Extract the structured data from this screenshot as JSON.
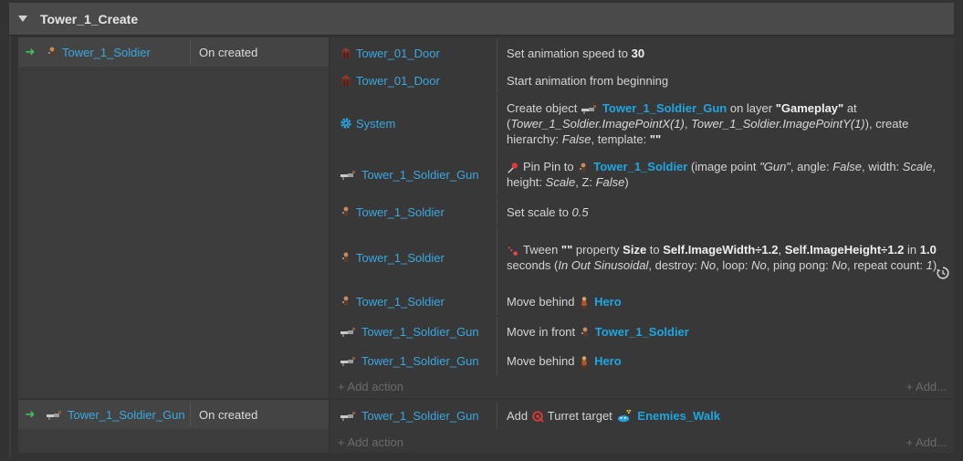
{
  "group": {
    "title": "Tower_1_Create"
  },
  "events": [
    {
      "object": "Tower_1_Soldier",
      "condition": "On created",
      "actions": [
        {
          "object": "Tower_01_Door",
          "text": [
            "Set animation speed to ",
            {
              "b": "30"
            }
          ]
        },
        {
          "object": "Tower_01_Door",
          "text": [
            "Start animation from beginning"
          ]
        },
        {
          "object": "System",
          "text": [
            "Create object ",
            {
              "icon": "soldier-gun-icon"
            },
            {
              "o": "Tower_1_Soldier_Gun"
            },
            " on layer ",
            {
              "b": "\"Gameplay\""
            },
            " at (",
            {
              "i": "Tower_1_Soldier.ImagePointX(1)"
            },
            ", ",
            {
              "i": "Tower_1_Soldier.ImagePointY(1)"
            },
            "), create hierarchy: ",
            {
              "i": "False"
            },
            ", template: ",
            {
              "b": "\"\""
            }
          ]
        },
        {
          "object": "Tower_1_Soldier_Gun",
          "text": [
            {
              "icon": "pin-icon"
            },
            "Pin Pin to ",
            {
              "icon": "soldier-icon"
            },
            {
              "o": "Tower_1_Soldier"
            },
            " (image point ",
            {
              "i": "\"Gun\""
            },
            ", angle: ",
            {
              "i": "False"
            },
            ", width: ",
            {
              "i": "Scale"
            },
            ", height: ",
            {
              "i": "Scale"
            },
            ", Z: ",
            {
              "i": "False"
            },
            ")"
          ]
        },
        {
          "object": "Tower_1_Soldier",
          "text": [
            "Set scale to ",
            {
              "i": "0.5"
            }
          ]
        },
        {
          "object": "Tower_1_Soldier",
          "text": [
            {
              "icon": "tween-icon"
            },
            "Tween ",
            {
              "b": "\"\""
            },
            " property ",
            {
              "b": "Size"
            },
            " to ",
            {
              "b": "Self.ImageWidth÷1.2"
            },
            ", ",
            {
              "b": "Self.ImageHeight÷1.2"
            },
            " in ",
            {
              "b": "1.0"
            },
            "  seconds (",
            {
              "i": "In Out Sinusoidal"
            },
            ", destroy: ",
            {
              "i": "No"
            },
            ", loop: ",
            {
              "i": "No"
            },
            ", ping pong: ",
            {
              "i": "No"
            },
            ", repeat count: ",
            {
              "i": "1"
            },
            ")"
          ]
        },
        {
          "object": "Tower_1_Soldier",
          "text": [
            "Move behind ",
            {
              "icon": "hero-icon"
            },
            {
              "o": "Hero"
            }
          ]
        },
        {
          "object": "Tower_1_Soldier_Gun",
          "text": [
            "Move in front ",
            {
              "icon": "soldier-icon"
            },
            {
              "o": "Tower_1_Soldier"
            }
          ]
        },
        {
          "object": "Tower_1_Soldier_Gun",
          "text": [
            "Move behind ",
            {
              "icon": "hero-icon"
            },
            {
              "o": "Hero"
            }
          ]
        }
      ],
      "add_action": "+ Add action",
      "add_right": "+ Add..."
    },
    {
      "object": "Tower_1_Soldier_Gun",
      "condition": "On created",
      "actions": [
        {
          "object": "Tower_1_Soldier_Gun",
          "text": [
            "Add ",
            {
              "icon": "turret-icon"
            },
            "Turret target ",
            {
              "icon": "enemies-icon"
            },
            {
              "o": "Enemies_Walk"
            }
          ]
        }
      ],
      "add_action": "+ Add action",
      "add_right": "+ Add..."
    }
  ],
  "icons": {
    "Tower_01_Door": "door-icon",
    "System": "gear-icon",
    "Tower_1_Soldier": "soldier-icon",
    "Tower_1_Soldier_Gun": "soldier-gun-icon"
  },
  "colors": {
    "object_link": "#3aa8e0",
    "trigger_arrow": "#3ec25e"
  }
}
